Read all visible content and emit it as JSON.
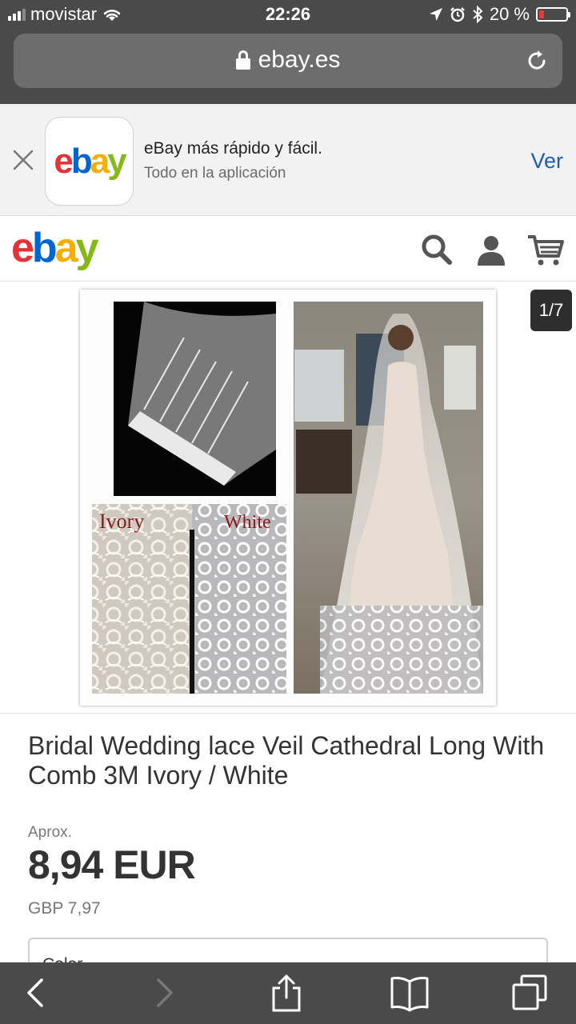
{
  "status_bar": {
    "carrier": "movistar",
    "time": "22:26",
    "battery_percent": "20 %",
    "battery_level": 0.2
  },
  "browser": {
    "url": "ebay.es"
  },
  "app_banner": {
    "title": "eBay más rápido y fácil.",
    "subtitle": "Todo en la aplicación",
    "action": "Ver",
    "logo_letters": [
      "e",
      "b",
      "a",
      "y"
    ]
  },
  "header": {
    "logo_letters": [
      "e",
      "b",
      "a",
      "y"
    ],
    "icons": [
      "search-icon",
      "user-icon",
      "cart-icon"
    ]
  },
  "gallery": {
    "counter": "1/7",
    "photo_labels": {
      "left": "Ivory",
      "right": "White"
    }
  },
  "product": {
    "title": "Bridal Wedding lace Veil Cathedral Long With Comb 3M Ivory / White",
    "price_prefix": "Aprox.",
    "price": "8,94 EUR",
    "original_price": "GBP 7,97",
    "option_label": "Color"
  },
  "colors": {
    "chrome": "#4a4a4a",
    "link": "#1a5fb4",
    "ebay_red": "#e53238",
    "ebay_blue": "#0064d2",
    "ebay_yellow": "#f5af02",
    "ebay_green": "#86b817"
  }
}
